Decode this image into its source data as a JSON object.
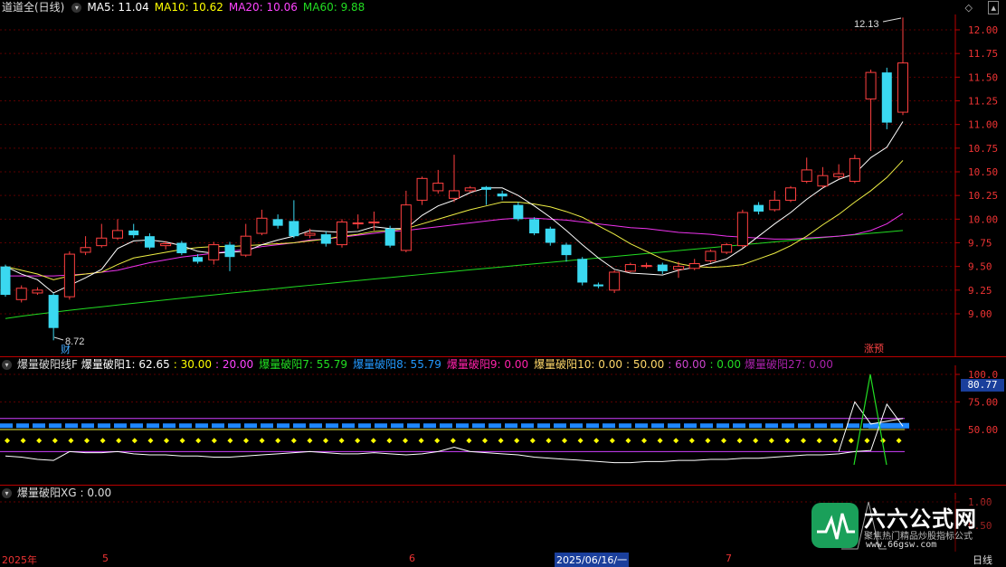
{
  "main_header": {
    "title": "道道全(日线)",
    "ma5": "MA5: 11.04",
    "ma10": "MA10: 10.62",
    "ma20": "MA20: 10.06",
    "ma60": "MA60: 9.88",
    "colors": {
      "ma5": "#ffffff",
      "ma10": "#ffff00",
      "ma20": "#ff44ff",
      "ma60": "#22dd22"
    }
  },
  "main_axis": [
    "12.00",
    "11.75",
    "11.50",
    "11.25",
    "11.00",
    "10.75",
    "10.50",
    "10.25",
    "10.00",
    "9.75",
    "9.50",
    "9.25",
    "9.00"
  ],
  "main_annotations": {
    "high": "12.13",
    "low": "8.72",
    "cai": "财",
    "zhangyu": "涨预"
  },
  "sub1_header": {
    "name": "爆量破阳线F",
    "p1": "爆量破阳1: 62.65",
    "v30": ": 30.00",
    "v20": ": 20.00",
    "p7": "爆量破阳7: 55.79",
    "p8": "爆量破阳8: 55.79",
    "p9": "爆量破阳9: 0.00",
    "p10": "爆量破阳10: 0.00",
    "v50": ": 50.00",
    "v60": ": 60.00",
    "v0": ": 0.00",
    "p27": "爆量破阳27: 0.00"
  },
  "sub1_axis": [
    "100.0",
    "75.00",
    "50.00"
  ],
  "sub1_badge": "80.77",
  "sub2_header": {
    "name": "爆量破阳XG",
    "value": ": 0.00"
  },
  "sub2_axis": [
    "1.00",
    "0.50"
  ],
  "date_axis": {
    "year": "2025年",
    "m5": "5",
    "m6": "6",
    "selected": "2025/06/16/一",
    "m7": "7",
    "period": "日线"
  },
  "brand": {
    "name": "六六公式网",
    "slogan": "聚焦热门精品炒股指标公式",
    "url": "www.66gsw.com"
  },
  "chart_data": {
    "type": "candlestick",
    "title": "道道全(日线)",
    "y_range": [
      8.72,
      12.13
    ],
    "candles": [
      {
        "o": 9.5,
        "c": 9.2,
        "h": 9.52,
        "l": 9.18
      },
      {
        "o": 9.15,
        "c": 9.27,
        "h": 9.3,
        "l": 9.12
      },
      {
        "o": 9.22,
        "c": 9.25,
        "h": 9.28,
        "l": 9.2
      },
      {
        "o": 9.2,
        "c": 8.85,
        "h": 9.22,
        "l": 8.72
      },
      {
        "o": 9.18,
        "c": 9.63,
        "h": 9.66,
        "l": 9.15
      },
      {
        "o": 9.65,
        "c": 9.7,
        "h": 9.82,
        "l": 9.62
      },
      {
        "o": 9.72,
        "c": 9.8,
        "h": 9.95,
        "l": 9.7
      },
      {
        "o": 9.8,
        "c": 9.88,
        "h": 10.0,
        "l": 9.78
      },
      {
        "o": 9.88,
        "c": 9.83,
        "h": 9.95,
        "l": 9.8
      },
      {
        "o": 9.82,
        "c": 9.7,
        "h": 9.85,
        "l": 9.68
      },
      {
        "o": 9.72,
        "c": 9.74,
        "h": 9.77,
        "l": 9.68
      },
      {
        "o": 9.75,
        "c": 9.64,
        "h": 9.77,
        "l": 9.62
      },
      {
        "o": 9.6,
        "c": 9.55,
        "h": 9.63,
        "l": 9.53
      },
      {
        "o": 9.57,
        "c": 9.73,
        "h": 9.76,
        "l": 9.52
      },
      {
        "o": 9.73,
        "c": 9.6,
        "h": 9.76,
        "l": 9.45
      },
      {
        "o": 9.62,
        "c": 9.82,
        "h": 9.95,
        "l": 9.6
      },
      {
        "o": 9.85,
        "c": 10.01,
        "h": 10.1,
        "l": 9.83
      },
      {
        "o": 10.0,
        "c": 9.93,
        "h": 10.05,
        "l": 9.9
      },
      {
        "o": 9.98,
        "c": 9.82,
        "h": 10.2,
        "l": 9.8
      },
      {
        "o": 9.83,
        "c": 9.85,
        "h": 9.9,
        "l": 9.8
      },
      {
        "o": 9.84,
        "c": 9.74,
        "h": 9.87,
        "l": 9.71
      },
      {
        "o": 9.73,
        "c": 9.97,
        "h": 10.0,
        "l": 9.7
      },
      {
        "o": 9.95,
        "c": 9.96,
        "h": 10.05,
        "l": 9.9
      },
      {
        "o": 9.96,
        "c": 9.97,
        "h": 10.08,
        "l": 9.88
      },
      {
        "o": 9.9,
        "c": 9.72,
        "h": 9.93,
        "l": 9.7
      },
      {
        "o": 9.67,
        "c": 10.15,
        "h": 10.3,
        "l": 9.65
      },
      {
        "o": 10.2,
        "c": 10.43,
        "h": 10.45,
        "l": 10.15
      },
      {
        "o": 10.3,
        "c": 10.38,
        "h": 10.52,
        "l": 10.27
      },
      {
        "o": 10.22,
        "c": 10.3,
        "h": 10.68,
        "l": 10.18
      },
      {
        "o": 10.3,
        "c": 10.33,
        "h": 10.35,
        "l": 10.28
      },
      {
        "o": 10.34,
        "c": 10.31,
        "h": 10.35,
        "l": 10.15
      },
      {
        "o": 10.27,
        "c": 10.24,
        "h": 10.3,
        "l": 10.2
      },
      {
        "o": 10.15,
        "c": 10.0,
        "h": 10.18,
        "l": 9.98
      },
      {
        "o": 10.0,
        "c": 9.85,
        "h": 10.02,
        "l": 9.83
      },
      {
        "o": 9.9,
        "c": 9.75,
        "h": 9.92,
        "l": 9.72
      },
      {
        "o": 9.73,
        "c": 9.62,
        "h": 9.75,
        "l": 9.55
      },
      {
        "o": 9.58,
        "c": 9.33,
        "h": 9.6,
        "l": 9.3
      },
      {
        "o": 9.31,
        "c": 9.29,
        "h": 9.33,
        "l": 9.27
      },
      {
        "o": 9.25,
        "c": 9.44,
        "h": 9.46,
        "l": 9.22
      },
      {
        "o": 9.45,
        "c": 9.52,
        "h": 9.54,
        "l": 9.44
      },
      {
        "o": 9.5,
        "c": 9.51,
        "h": 9.54,
        "l": 9.48
      },
      {
        "o": 9.52,
        "c": 9.45,
        "h": 9.54,
        "l": 9.42
      },
      {
        "o": 9.47,
        "c": 9.5,
        "h": 9.55,
        "l": 9.38
      },
      {
        "o": 9.48,
        "c": 9.53,
        "h": 9.58,
        "l": 9.46
      },
      {
        "o": 9.56,
        "c": 9.66,
        "h": 9.68,
        "l": 9.54
      },
      {
        "o": 9.65,
        "c": 9.73,
        "h": 9.75,
        "l": 9.63
      },
      {
        "o": 9.72,
        "c": 10.07,
        "h": 10.1,
        "l": 9.7
      },
      {
        "o": 10.15,
        "c": 10.08,
        "h": 10.18,
        "l": 10.05
      },
      {
        "o": 10.1,
        "c": 10.2,
        "h": 10.3,
        "l": 10.08
      },
      {
        "o": 10.2,
        "c": 10.33,
        "h": 10.35,
        "l": 10.18
      },
      {
        "o": 10.4,
        "c": 10.52,
        "h": 10.65,
        "l": 10.38
      },
      {
        "o": 10.35,
        "c": 10.46,
        "h": 10.55,
        "l": 10.33
      },
      {
        "o": 10.45,
        "c": 10.48,
        "h": 10.58,
        "l": 10.42
      },
      {
        "o": 10.4,
        "c": 10.64,
        "h": 10.68,
        "l": 10.38
      },
      {
        "o": 11.27,
        "c": 11.55,
        "h": 11.58,
        "l": 10.72
      },
      {
        "o": 11.55,
        "c": 11.02,
        "h": 11.6,
        "l": 10.95
      },
      {
        "o": 11.13,
        "c": 11.65,
        "h": 12.13,
        "l": 11.1
      }
    ],
    "ma5": [
      9.5,
      9.42,
      9.36,
      9.22,
      9.3,
      9.38,
      9.47,
      9.69,
      9.77,
      9.78,
      9.76,
      9.72,
      9.66,
      9.64,
      9.65,
      9.66,
      9.73,
      9.78,
      9.82,
      9.88,
      9.87,
      9.86,
      9.87,
      9.92,
      9.9,
      9.9,
      10.04,
      10.14,
      10.2,
      10.28,
      10.33,
      10.33,
      10.25,
      10.14,
      10.02,
      9.88,
      9.73,
      9.59,
      9.47,
      9.43,
      9.42,
      9.41,
      9.46,
      9.49,
      9.53,
      9.58,
      9.69,
      9.82,
      9.95,
      10.07,
      10.21,
      10.33,
      10.42,
      10.48,
      10.65,
      10.76,
      11.03
    ],
    "ma10": [
      9.5,
      9.46,
      9.42,
      9.36,
      9.4,
      9.42,
      9.44,
      9.52,
      9.59,
      9.62,
      9.65,
      9.68,
      9.7,
      9.71,
      9.71,
      9.72,
      9.73,
      9.74,
      9.75,
      9.77,
      9.79,
      9.82,
      9.84,
      9.87,
      9.88,
      9.9,
      9.95,
      10.0,
      10.05,
      10.1,
      10.14,
      10.18,
      10.18,
      10.16,
      10.13,
      10.08,
      10.02,
      9.93,
      9.84,
      9.74,
      9.66,
      9.58,
      9.53,
      9.5,
      9.49,
      9.5,
      9.52,
      9.58,
      9.64,
      9.72,
      9.82,
      9.94,
      10.05,
      10.18,
      10.3,
      10.44,
      10.62
    ],
    "ma20": [
      9.4,
      9.4,
      9.4,
      9.4,
      9.41,
      9.42,
      9.44,
      9.46,
      9.5,
      9.54,
      9.57,
      9.6,
      9.62,
      9.64,
      9.66,
      9.68,
      9.71,
      9.73,
      9.75,
      9.78,
      9.79,
      9.81,
      9.83,
      9.85,
      9.87,
      9.88,
      9.9,
      9.92,
      9.94,
      9.96,
      9.98,
      10.0,
      10.01,
      10.01,
      10.0,
      9.99,
      9.97,
      9.95,
      9.93,
      9.91,
      9.9,
      9.88,
      9.86,
      9.85,
      9.84,
      9.82,
      9.81,
      9.8,
      9.79,
      9.79,
      9.8,
      9.81,
      9.82,
      9.84,
      9.88,
      9.95,
      10.06
    ],
    "ma60_start": 8.95,
    "ma60_end": 9.88
  }
}
